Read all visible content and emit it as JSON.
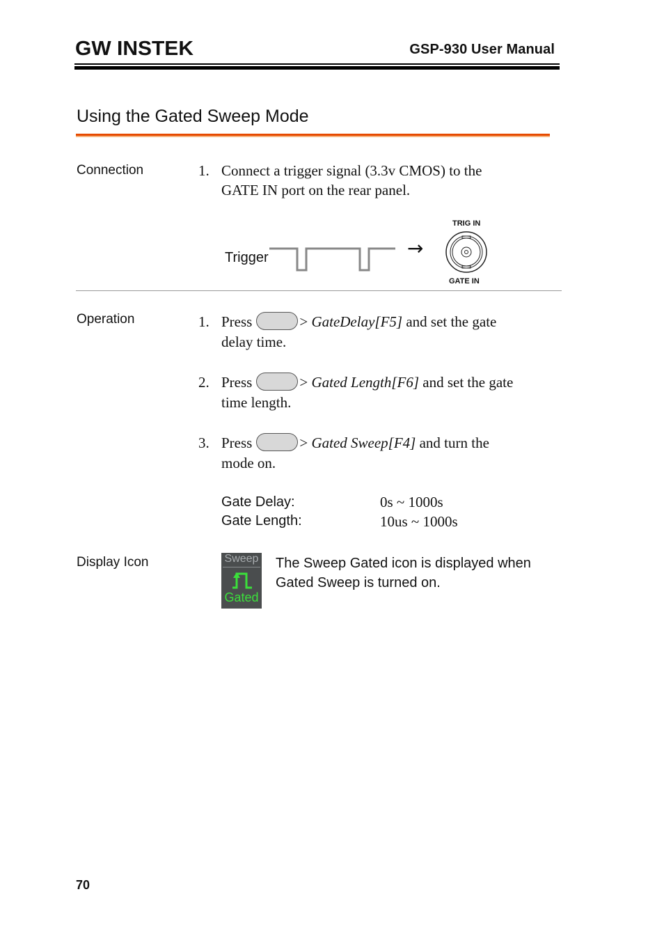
{
  "header": {
    "brand": "GW INSTEK",
    "manual_title": "GSP-930 User Manual"
  },
  "section": {
    "title": "Using the Gated Sweep Mode",
    "accent_color": "#e64a00"
  },
  "connection": {
    "label": "Connection",
    "steps": [
      {
        "number": "1.",
        "line1": "Connect a trigger signal (3.3v CMOS) to the",
        "line2": "GATE IN port on the rear panel."
      }
    ],
    "diagram": {
      "signal_label": "Trigger",
      "arrow": "→",
      "connector_top_label": "TRIG IN",
      "connector_bottom_label": "GATE IN"
    }
  },
  "operation": {
    "label": "Operation",
    "steps": [
      {
        "number": "1.",
        "press": "Press",
        "gt": ">",
        "softkey": "GateDelay[F5]",
        "rest": " and set the gate",
        "line2": "delay time."
      },
      {
        "number": "2.",
        "press": "Press",
        "gt": ">",
        "softkey": "Gated Length[F6]",
        "rest": " and set the gate",
        "line2": "time length."
      },
      {
        "number": "3.",
        "press": "Press",
        "gt": ">",
        "softkey": "Gated Sweep[F4]",
        "rest": " and turn the",
        "line2": "mode on."
      }
    ],
    "specs": [
      {
        "label": "Gate Delay:",
        "value": "0s ~ 1000s"
      },
      {
        "label": "Gate Length:",
        "value": "10us ~ 1000s"
      }
    ]
  },
  "display_icon": {
    "label": "Display Icon",
    "icon_top_text": "Sweep",
    "icon_bottom_text": "Gated",
    "icon_color": "#3be03b",
    "description_line1": "The Sweep Gated icon is displayed when",
    "description_line2": "Gated Sweep is turned on."
  },
  "footer": {
    "page_number": "70"
  }
}
